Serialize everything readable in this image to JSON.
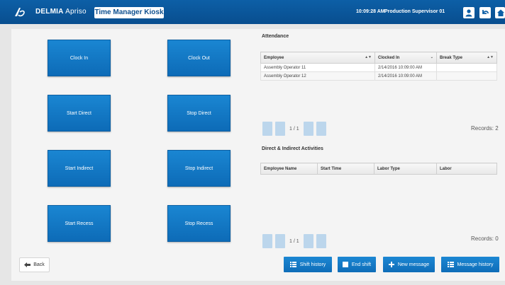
{
  "header": {
    "brand_bold": "DELMIA",
    "brand_thin": "Apriso",
    "app_title": "Time Manager Kiosk",
    "time": "10:09:28 AM",
    "user": "Production Supervisor 01"
  },
  "tiles": {
    "clock_in": "Clock In",
    "clock_out": "Clock Out",
    "start_direct": "Start Direct",
    "stop_direct": "Stop Direct",
    "start_indirect": "Start Indirect",
    "stop_indirect": "Stop Indirect",
    "start_recess": "Start Recess",
    "stop_recess": "Stop Recess"
  },
  "attendance": {
    "title": "Attendance",
    "columns": [
      "Employee",
      "Clocked In",
      "Break Type"
    ],
    "rows": [
      [
        "Assembly Operator 11",
        "2/14/2016 10:09:00 AM",
        ""
      ],
      [
        "Assembly Operator 12",
        "2/14/2016 10:09:00 AM",
        ""
      ]
    ],
    "page_info": "1 / 1",
    "records": "Records: 2"
  },
  "activities": {
    "title": "Direct & Indirect Activities",
    "columns": [
      "Employee Name",
      "Start Time",
      "Labor Type",
      "Labor"
    ],
    "page_info": "1 / 1",
    "records": "Records: 0"
  },
  "footer": {
    "back": "Back",
    "shift_history": "Shift history",
    "end_shift": "End shift",
    "new_message": "New message",
    "message_history": "Message history"
  }
}
